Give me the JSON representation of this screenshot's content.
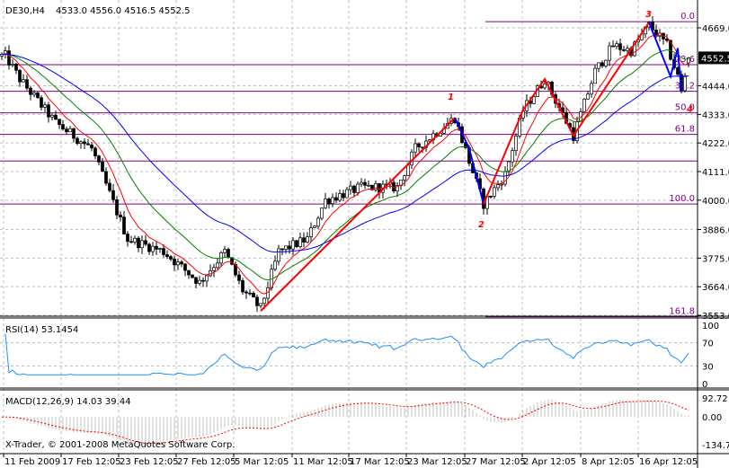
{
  "chart_data": {
    "type": "candlestick",
    "title": "DE30,H4",
    "ohlc": "4533.0 4556.0 4516.5 4552.5",
    "current_price": "4552.5",
    "price_ticks": [
      "4669.0",
      "4444.0",
      "4333.0",
      "4222.0",
      "4111.0",
      "4000.0",
      "3886.0",
      "3775.0",
      "3664.0",
      "3553.0"
    ],
    "price_tick_values": [
      4669,
      4444,
      4333,
      4222,
      4111,
      4000,
      3886,
      3775,
      3664,
      3553
    ],
    "ylim": [
      3553,
      4669
    ],
    "date_ticks": [
      "11 Feb 2009",
      "17 Feb 12:05",
      "23 Feb 12:05",
      "27 Feb 12:05",
      "5 Mar 12:05",
      "11 Mar 12:05",
      "17 Mar 12:05",
      "23 Mar 12:05",
      "27 Mar 12:05",
      "2 Apr 12:05",
      "8 Apr 12:05",
      "16 Apr 12:05"
    ],
    "approx_price_path": [
      [
        1,
        4560
      ],
      [
        5,
        4470
      ],
      [
        15,
        4300
      ],
      [
        25,
        4200
      ],
      [
        35,
        3850
      ],
      [
        45,
        3800
      ],
      [
        55,
        3680
      ],
      [
        62,
        3800
      ],
      [
        67,
        3650
      ],
      [
        72,
        3580
      ],
      [
        77,
        3800
      ],
      [
        85,
        3850
      ],
      [
        90,
        4000
      ],
      [
        100,
        4050
      ],
      [
        110,
        4050
      ],
      [
        115,
        4200
      ],
      [
        126,
        4320
      ],
      [
        130,
        4150
      ],
      [
        134,
        3985
      ],
      [
        140,
        4100
      ],
      [
        145,
        4350
      ],
      [
        151,
        4470
      ],
      [
        159,
        4250
      ],
      [
        165,
        4500
      ],
      [
        170,
        4600
      ],
      [
        175,
        4580
      ],
      [
        180,
        4680
      ],
      [
        185,
        4600
      ],
      [
        188,
        4480
      ],
      [
        189,
        4420
      ],
      [
        191,
        4552.5
      ]
    ],
    "moving_averages": [
      {
        "color": "#ff0000",
        "period": 8
      },
      {
        "color": "#008000",
        "period": 21
      },
      {
        "color": "#0000ff",
        "period": 45
      }
    ],
    "fibonacci": {
      "high": 4693,
      "low": 3985,
      "levels": [
        {
          "ratio": 0,
          "label": "0.0"
        },
        {
          "ratio": 0.236,
          "label": "23.6"
        },
        {
          "ratio": 0.382,
          "label": "38.2"
        },
        {
          "ratio": 0.5,
          "label": "50.0"
        },
        {
          "ratio": 0.618,
          "label": "61.8"
        },
        {
          "ratio": 0.764,
          "label": ""
        },
        {
          "ratio": 1,
          "label": "100.0"
        },
        {
          "ratio": 1.618,
          "label": "161.8"
        }
      ]
    },
    "waves": [
      {
        "label": "1",
        "bar": 126,
        "price": 4320
      },
      {
        "label": "2",
        "bar": 134,
        "price": 3985
      },
      {
        "label": "3",
        "bar": 180,
        "price": 4690
      },
      {
        "label": "4",
        "bar": 189,
        "price": 4420
      }
    ],
    "rsi": {
      "label": "RSI(14) 53.1454",
      "period": 14,
      "ticks": [
        "100",
        "70",
        "30",
        "0"
      ],
      "color": "#1e90ff"
    },
    "macd": {
      "label": "MACD(12,26,9) 14.03 39.44",
      "ticks": [
        "92.72",
        "0.00",
        "-134.79"
      ],
      "ylim": [
        -134.79,
        92.72
      ]
    },
    "copyright": "X-Trader, © 2001-2008 MetaQuotes Software Corp."
  }
}
